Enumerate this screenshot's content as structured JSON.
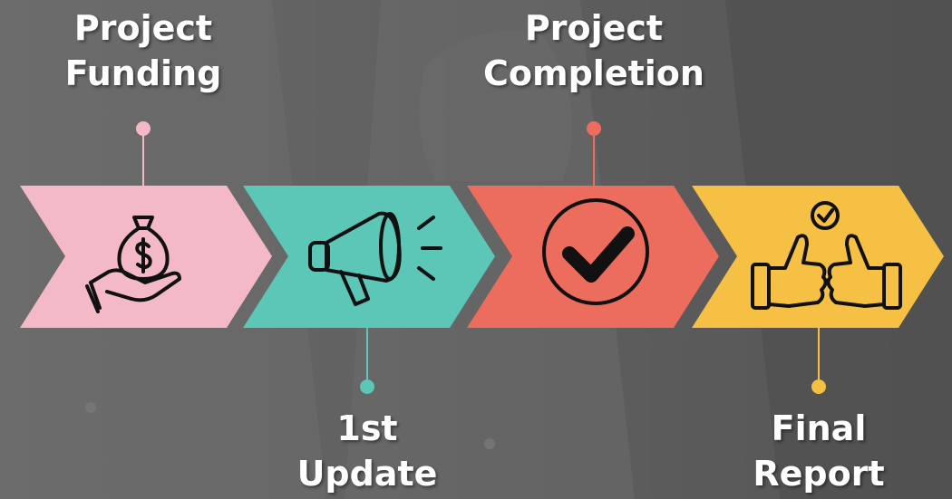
{
  "steps": [
    {
      "line1": "Project",
      "line2": "Funding",
      "color": "#f4b9c6",
      "icon": "money-bag-in-hand-icon",
      "label_position": "top"
    },
    {
      "line1": "1st",
      "line2": "Update",
      "color": "#5cc6b7",
      "icon": "megaphone-icon",
      "label_position": "bottom"
    },
    {
      "line1": "Project",
      "line2": "Completion",
      "color": "#ec6c5e",
      "icon": "check-circle-icon",
      "label_position": "top"
    },
    {
      "line1": "Final",
      "line2": "Report",
      "color": "#f5c043",
      "icon": "thumbs-up-check-icon",
      "label_position": "bottom"
    }
  ],
  "background": {
    "overlay_color": "#5c5c5c"
  }
}
